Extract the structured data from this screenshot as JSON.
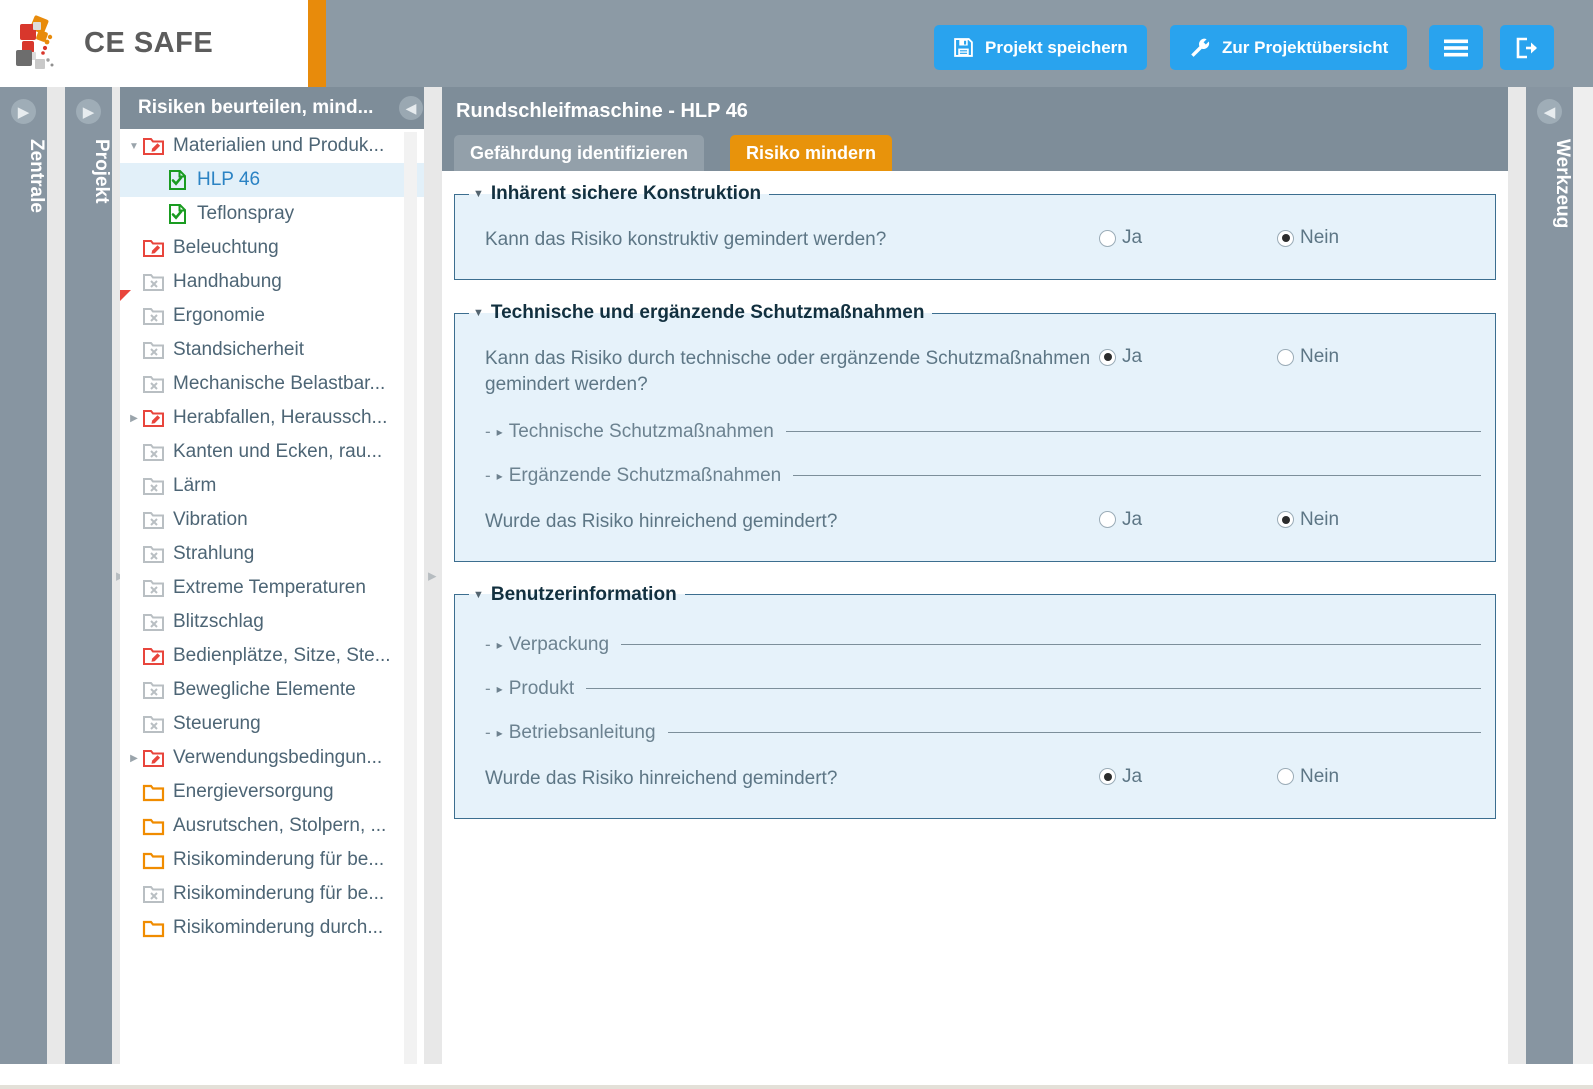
{
  "brand": {
    "name": "CE SAFE",
    "accent_color": "#e88b0b"
  },
  "header": {
    "buttons": [
      {
        "id": "save",
        "label": "Projekt speichern",
        "icon": "floppy-disk-icon"
      },
      {
        "id": "overview",
        "label": "Zur Projektübersicht",
        "icon": "wrench-icon"
      },
      {
        "id": "menu",
        "label": "",
        "icon": "hamburger-menu-icon"
      },
      {
        "id": "logout",
        "label": "",
        "icon": "logout-icon"
      }
    ],
    "button_color": "#29a3ee"
  },
  "vertical_tabs": [
    {
      "id": "zentrale",
      "label": "Zentrale",
      "icon": "chevron-right-circle-icon"
    },
    {
      "id": "projekt",
      "label": "Projekt",
      "icon": "chevron-right-circle-icon"
    },
    {
      "id": "werkzeug",
      "label": "Werkzeug",
      "icon": "chevron-left-circle-icon"
    }
  ],
  "tree": {
    "header_title": "Risiken beurteilen, mind...",
    "collapse_icon": "chevron-left-circle-icon",
    "items": [
      {
        "label": "Materialien und Produk...",
        "icon": "folder-edit-red-icon",
        "indent": 1,
        "twist": "down",
        "selected": false
      },
      {
        "label": "HLP 46",
        "icon": "document-check-green-icon",
        "indent": 2,
        "twist": "",
        "selected": true
      },
      {
        "label": "Teflonspray",
        "icon": "document-check-green-icon",
        "indent": 2,
        "twist": "",
        "selected": false
      },
      {
        "label": "Beleuchtung",
        "icon": "folder-edit-red-icon",
        "indent": 1,
        "twist": "",
        "selected": false
      },
      {
        "label": "Handhabung",
        "icon": "folder-x-gray-icon",
        "indent": 1,
        "twist": "",
        "selected": false
      },
      {
        "label": "Ergonomie",
        "icon": "folder-x-gray-icon",
        "indent": 1,
        "twist": "",
        "selected": false
      },
      {
        "label": "Standsicherheit",
        "icon": "folder-x-gray-icon",
        "indent": 1,
        "twist": "",
        "selected": false
      },
      {
        "label": "Mechanische Belastbar...",
        "icon": "folder-x-gray-icon",
        "indent": 1,
        "twist": "",
        "selected": false
      },
      {
        "label": "Herabfallen, Heraussch...",
        "icon": "folder-edit-red-icon",
        "indent": 1,
        "twist": "right",
        "selected": false
      },
      {
        "label": "Kanten und Ecken, rau...",
        "icon": "folder-x-gray-icon",
        "indent": 1,
        "twist": "",
        "selected": false
      },
      {
        "label": "Lärm",
        "icon": "folder-x-gray-icon",
        "indent": 1,
        "twist": "",
        "selected": false
      },
      {
        "label": "Vibration",
        "icon": "folder-x-gray-icon",
        "indent": 1,
        "twist": "",
        "selected": false
      },
      {
        "label": "Strahlung",
        "icon": "folder-x-gray-icon",
        "indent": 1,
        "twist": "",
        "selected": false
      },
      {
        "label": "Extreme Temperaturen",
        "icon": "folder-x-gray-icon",
        "indent": 1,
        "twist": "",
        "selected": false
      },
      {
        "label": "Blitzschlag",
        "icon": "folder-x-gray-icon",
        "indent": 1,
        "twist": "",
        "selected": false
      },
      {
        "label": "Bedienplätze, Sitze, Ste...",
        "icon": "folder-edit-red-icon",
        "indent": 1,
        "twist": "",
        "selected": false
      },
      {
        "label": "Bewegliche Elemente",
        "icon": "folder-x-gray-icon",
        "indent": 1,
        "twist": "",
        "selected": false
      },
      {
        "label": "Steuerung",
        "icon": "folder-x-gray-icon",
        "indent": 1,
        "twist": "",
        "selected": false
      },
      {
        "label": "Verwendungsbedingun...",
        "icon": "folder-edit-red-icon",
        "indent": 1,
        "twist": "right",
        "selected": false
      },
      {
        "label": "Energieversorgung",
        "icon": "folder-open-orange-icon",
        "indent": 1,
        "twist": "",
        "selected": false
      },
      {
        "label": "Ausrutschen, Stolpern, ...",
        "icon": "folder-open-orange-icon",
        "indent": 1,
        "twist": "",
        "selected": false
      },
      {
        "label": "Risikominderung für be...",
        "icon": "folder-open-orange-icon",
        "indent": 1,
        "twist": "",
        "selected": false
      },
      {
        "label": "Risikominderung für be...",
        "icon": "folder-x-gray-icon",
        "indent": 1,
        "twist": "",
        "selected": false
      },
      {
        "label": "Risikominderung durch...",
        "icon": "folder-open-orange-icon",
        "indent": 1,
        "twist": "",
        "selected": false
      }
    ]
  },
  "main": {
    "title": "Rundschleifmaschine - HLP 46",
    "tabs": [
      {
        "label": "Gefährdung identifizieren",
        "active": false
      },
      {
        "label": "Risiko mindern",
        "active": true
      }
    ],
    "active_tab_color": "#e8930b",
    "sections": [
      {
        "legend": "Inhärent sichere Konstruktion",
        "questions": [
          {
            "text": "Kann das Risiko konstruktiv gemindert werden?",
            "options": [
              {
                "label": "Ja",
                "selected": false
              },
              {
                "label": "Nein",
                "selected": true
              }
            ]
          }
        ],
        "subsections": []
      },
      {
        "legend": "Technische und ergänzende Schutzmaßnahmen",
        "questions": [
          {
            "text": "Kann das Risiko durch technische oder ergänzende Schutzmaßnahmen gemindert werden?",
            "options": [
              {
                "label": "Ja",
                "selected": true
              },
              {
                "label": "Nein",
                "selected": false
              }
            ]
          }
        ],
        "subsections": [
          {
            "label": "Technische Schutzmaßnahmen"
          },
          {
            "label": "Ergänzende Schutzmaßnahmen"
          }
        ],
        "trailing_question": {
          "text": "Wurde das Risiko hinreichend gemindert?",
          "options": [
            {
              "label": "Ja",
              "selected": false
            },
            {
              "label": "Nein",
              "selected": true
            }
          ]
        }
      },
      {
        "legend": "Benutzerinformation",
        "questions": [],
        "subsections": [
          {
            "label": "Verpackung"
          },
          {
            "label": "Produkt"
          },
          {
            "label": "Betriebsanleitung"
          }
        ],
        "trailing_question": {
          "text": "Wurde das Risiko hinreichend gemindert?",
          "options": [
            {
              "label": "Ja",
              "selected": true
            },
            {
              "label": "Nein",
              "selected": false
            }
          ]
        }
      }
    ]
  }
}
